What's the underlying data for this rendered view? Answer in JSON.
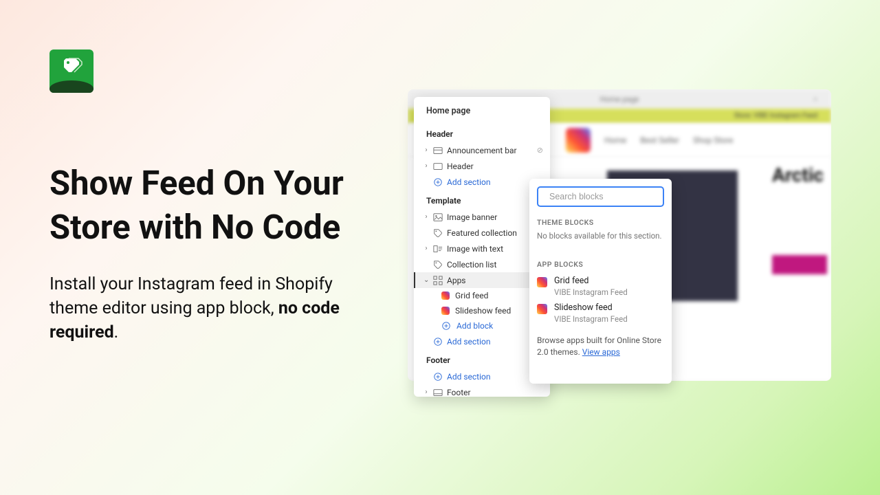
{
  "hero": {
    "title": "Show Feed On Your Store with No Code",
    "subtitle_prefix": "Install your Instagram feed in Shopify theme editor using app block, ",
    "subtitle_bold": "no code required",
    "subtitle_suffix": "."
  },
  "preview": {
    "page_label": "Home page",
    "notice": "Store: VIBE Instagram Feed",
    "nav": {
      "home": "Home",
      "best": "Best Seller",
      "shop": "Shop Store"
    },
    "product_title": "Arctic"
  },
  "panel": {
    "title": "Home page",
    "groups": {
      "header": {
        "label": "Header",
        "items": [
          {
            "label": "Announcement bar",
            "has_eye": true
          },
          {
            "label": "Header",
            "has_eye": false
          }
        ],
        "add": "Add section"
      },
      "template": {
        "label": "Template",
        "items": [
          {
            "label": "Image banner"
          },
          {
            "label": "Featured collection"
          },
          {
            "label": "Image with text"
          },
          {
            "label": "Collection list"
          },
          {
            "label": "Apps",
            "selected": true,
            "children": [
              {
                "label": "Grid feed"
              },
              {
                "label": "Slideshow feed"
              }
            ],
            "add_block": "Add block"
          }
        ],
        "add": "Add section"
      },
      "footer": {
        "label": "Footer",
        "add": "Add section",
        "items": [
          {
            "label": "Footer"
          }
        ]
      }
    }
  },
  "popup": {
    "search_placeholder": "Search blocks",
    "theme_blocks_header": "THEME BLOCKS",
    "theme_blocks_empty": "No blocks available for this section.",
    "app_blocks_header": "APP BLOCKS",
    "blocks": [
      {
        "name": "Grid feed",
        "source": "VIBE Instagram Feed"
      },
      {
        "name": "Slideshow feed",
        "source": "VIBE Instagram Feed"
      }
    ],
    "footer_text": "Browse apps built for Online Store 2.0 themes. ",
    "footer_link": "View apps"
  }
}
